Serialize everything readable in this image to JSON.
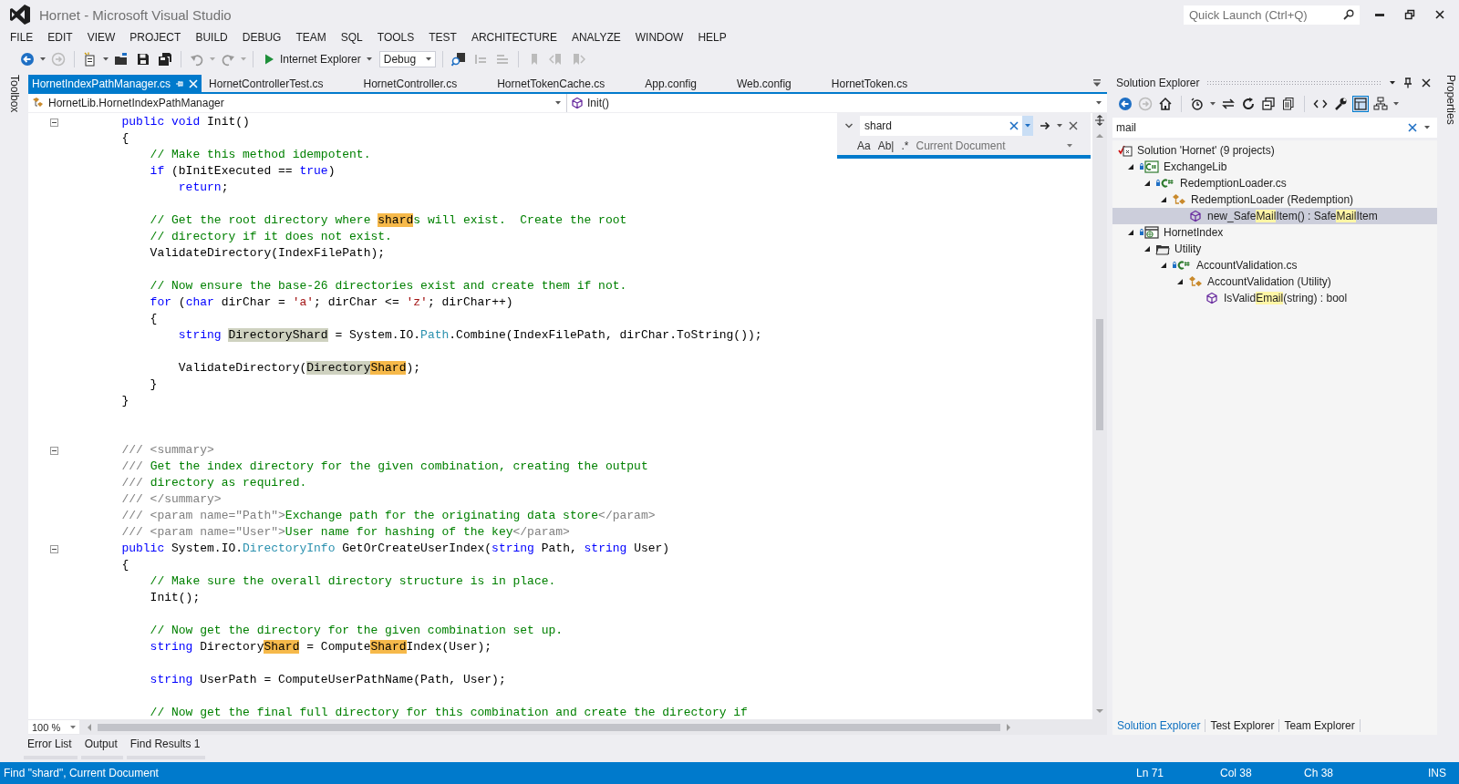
{
  "window": {
    "title": "Hornet - Microsoft Visual Studio"
  },
  "quick_launch": {
    "placeholder": "Quick Launch (Ctrl+Q)"
  },
  "menu": [
    "FILE",
    "EDIT",
    "VIEW",
    "PROJECT",
    "BUILD",
    "DEBUG",
    "TEAM",
    "SQL",
    "TOOLS",
    "TEST",
    "ARCHITECTURE",
    "ANALYZE",
    "WINDOW",
    "HELP"
  ],
  "toolbar": {
    "browser": "Internet Explorer",
    "configuration": "Debug"
  },
  "side_tabs": {
    "left": "Toolbox",
    "right": "Properties"
  },
  "editor": {
    "tabs": [
      {
        "label": "HornetIndexPathManager.cs",
        "selected": true
      },
      {
        "label": "HornetControllerTest.cs",
        "selected": false
      },
      {
        "label": "HornetController.cs",
        "selected": false
      },
      {
        "label": "HornetTokenCache.cs",
        "selected": false
      },
      {
        "label": "App.config",
        "selected": false
      },
      {
        "label": "Web.config",
        "selected": false
      },
      {
        "label": "HornetToken.cs",
        "selected": false
      }
    ],
    "nav": {
      "type": "HornetLib.HornetIndexPathManager",
      "member": "Init()"
    },
    "lines": [
      {
        "kind": "fold",
        "tokens": [
          {
            "text": "        public void",
            "kind": "kw"
          },
          {
            "text": " Init()",
            "kind": "plain"
          }
        ]
      },
      {
        "kind": "code",
        "tokens": [
          {
            "text": "        {",
            "kind": "plain"
          }
        ]
      },
      {
        "kind": "code",
        "tokens": [
          {
            "text": "            // Make this method idempotent.",
            "kind": "comment"
          }
        ]
      },
      {
        "kind": "code",
        "tokens": [
          {
            "text": "            if",
            "kind": "kw"
          },
          {
            "text": " (bInitExecuted == ",
            "kind": "plain"
          },
          {
            "text": "true",
            "kind": "kw"
          },
          {
            "text": ")",
            "kind": "plain"
          }
        ]
      },
      {
        "kind": "code",
        "tokens": [
          {
            "text": "                return",
            "kind": "kw"
          },
          {
            "text": ";",
            "kind": "plain"
          }
        ]
      },
      {
        "kind": "blank"
      },
      {
        "kind": "code",
        "tokens": [
          {
            "text": "            // Get the root directory where ",
            "kind": "comment"
          },
          {
            "text": "shard",
            "kind": "match"
          },
          {
            "text": "s will exist.  Create the root",
            "kind": "comment"
          }
        ]
      },
      {
        "kind": "code",
        "tokens": [
          {
            "text": "            // directory if it does not exist.",
            "kind": "comment"
          }
        ]
      },
      {
        "kind": "code",
        "tokens": [
          {
            "text": "            ValidateDirectory(IndexFilePath);",
            "kind": "plain"
          }
        ]
      },
      {
        "kind": "blank"
      },
      {
        "kind": "code",
        "tokens": [
          {
            "text": "            // Now ensure the base-26 directories exist and create them if not.",
            "kind": "comment"
          }
        ]
      },
      {
        "kind": "code",
        "tokens": [
          {
            "text": "            for",
            "kind": "kw"
          },
          {
            "text": " (",
            "kind": "plain"
          },
          {
            "text": "char",
            "kind": "kw"
          },
          {
            "text": " dirChar = ",
            "kind": "plain"
          },
          {
            "text": "'a'",
            "kind": "string"
          },
          {
            "text": "; dirChar <= ",
            "kind": "plain"
          },
          {
            "text": "'z'",
            "kind": "string"
          },
          {
            "text": "; dirChar++)",
            "kind": "plain"
          }
        ]
      },
      {
        "kind": "code",
        "tokens": [
          {
            "text": "            {",
            "kind": "plain"
          }
        ]
      },
      {
        "kind": "code",
        "tokens": [
          {
            "text": "                string ",
            "kind": "kw"
          },
          {
            "text": "DirectoryShard",
            "kind": "ref"
          },
          {
            "text": " = System.IO.",
            "kind": "plain"
          },
          {
            "text": "Path",
            "kind": "type"
          },
          {
            "text": ".Combine(IndexFilePath, dirChar.ToString());",
            "kind": "plain"
          }
        ]
      },
      {
        "kind": "blank"
      },
      {
        "kind": "code",
        "tokens": [
          {
            "text": "                ValidateDirectory(",
            "kind": "plain"
          },
          {
            "text": "Directory",
            "kind": "ref"
          },
          {
            "text": "Shard",
            "kind": "match"
          },
          {
            "text": ");",
            "kind": "plain"
          }
        ]
      },
      {
        "kind": "code",
        "tokens": [
          {
            "text": "            }",
            "kind": "plain"
          }
        ]
      },
      {
        "kind": "code",
        "tokens": [
          {
            "text": "        }",
            "kind": "plain"
          }
        ]
      },
      {
        "kind": "blank"
      },
      {
        "kind": "blank"
      },
      {
        "kind": "fold",
        "tokens": [
          {
            "text": "        /// <summary>",
            "kind": "doc"
          }
        ]
      },
      {
        "kind": "code",
        "tokens": [
          {
            "text": "        ///",
            "kind": "doc"
          },
          {
            "text": " Get the index directory for the given combination, creating the output",
            "kind": "comment"
          }
        ]
      },
      {
        "kind": "code",
        "tokens": [
          {
            "text": "        ///",
            "kind": "doc"
          },
          {
            "text": " directory as required.",
            "kind": "comment"
          }
        ]
      },
      {
        "kind": "code",
        "tokens": [
          {
            "text": "        /// </summary>",
            "kind": "doc"
          }
        ]
      },
      {
        "kind": "code",
        "tokens": [
          {
            "text": "        /// <param name=\"Path\">",
            "kind": "doc"
          },
          {
            "text": "Exchange path for the originating data store",
            "kind": "comment"
          },
          {
            "text": "</param>",
            "kind": "doc"
          }
        ]
      },
      {
        "kind": "code",
        "tokens": [
          {
            "text": "        /// <param name=\"User\">",
            "kind": "doc"
          },
          {
            "text": "User name for hashing of the key",
            "kind": "comment"
          },
          {
            "text": "</param>",
            "kind": "doc"
          }
        ]
      },
      {
        "kind": "fold",
        "tokens": [
          {
            "text": "        public ",
            "kind": "kw"
          },
          {
            "text": "System.IO.",
            "kind": "plain"
          },
          {
            "text": "DirectoryInfo",
            "kind": "type"
          },
          {
            "text": " GetOrCreateUserIndex(",
            "kind": "plain"
          },
          {
            "text": "string",
            "kind": "kw"
          },
          {
            "text": " Path, ",
            "kind": "plain"
          },
          {
            "text": "string",
            "kind": "kw"
          },
          {
            "text": " User)",
            "kind": "plain"
          }
        ]
      },
      {
        "kind": "code",
        "tokens": [
          {
            "text": "        {",
            "kind": "plain"
          }
        ]
      },
      {
        "kind": "code",
        "tokens": [
          {
            "text": "            // Make sure the overall directory structure is in place.",
            "kind": "comment"
          }
        ]
      },
      {
        "kind": "code",
        "tokens": [
          {
            "text": "            Init();",
            "kind": "plain"
          }
        ]
      },
      {
        "kind": "blank"
      },
      {
        "kind": "code",
        "tokens": [
          {
            "text": "            // Now get the directory for the given combination set up.",
            "kind": "comment"
          }
        ]
      },
      {
        "kind": "code",
        "tokens": [
          {
            "text": "            string ",
            "kind": "kw"
          },
          {
            "text": "Directory",
            "kind": "plain"
          },
          {
            "text": "Shard",
            "kind": "match"
          },
          {
            "text": " = Compute",
            "kind": "plain"
          },
          {
            "text": "Shard",
            "kind": "match"
          },
          {
            "text": "Index(User);",
            "kind": "plain"
          }
        ]
      },
      {
        "kind": "blank"
      },
      {
        "kind": "code",
        "tokens": [
          {
            "text": "            string ",
            "kind": "kw"
          },
          {
            "text": "UserPath = ComputeUserPathName(Path, User);",
            "kind": "plain"
          }
        ]
      },
      {
        "kind": "blank"
      },
      {
        "kind": "code",
        "tokens": [
          {
            "text": "            // Now get the final full directory for this combination and create the directory if",
            "kind": "comment"
          }
        ]
      }
    ],
    "zoom": "100 %"
  },
  "find": {
    "query": "shard",
    "options": [
      "Aa",
      "Ab|",
      ".*"
    ],
    "scope": "Current Document"
  },
  "solution_explorer": {
    "title": "Solution Explorer",
    "search": "mail",
    "tree": [
      {
        "kind": "solution",
        "selected": false,
        "label": [
          {
            "text": "Solution 'Hornet' (9 projects)",
            "match": false
          }
        ],
        "children": [
          {
            "kind": "csproj",
            "expanded": true,
            "selected": false,
            "label": [
              {
                "text": "ExchangeLib",
                "match": false
              }
            ],
            "children": [
              {
                "kind": "csfile",
                "expanded": true,
                "selected": false,
                "label": [
                  {
                    "text": "RedemptionLoader.cs",
                    "match": false
                  }
                ],
                "children": [
                  {
                    "kind": "class",
                    "expanded": true,
                    "selected": false,
                    "label": [
                      {
                        "text": "RedemptionLoader  (Redemption)",
                        "match": false
                      }
                    ],
                    "children": [
                      {
                        "kind": "method",
                        "selected": true,
                        "label": [
                          {
                            "text": "new_Safe",
                            "match": false
                          },
                          {
                            "text": "Mail",
                            "match": true
                          },
                          {
                            "text": "Item() : Safe",
                            "match": false
                          },
                          {
                            "text": "Mail",
                            "match": true
                          },
                          {
                            "text": "Item",
                            "match": false
                          }
                        ]
                      }
                    ]
                  }
                ]
              }
            ]
          },
          {
            "kind": "webproj",
            "expanded": true,
            "selected": false,
            "label": [
              {
                "text": "HornetIndex",
                "match": false
              }
            ],
            "children": [
              {
                "kind": "folder",
                "expanded": true,
                "selected": false,
                "label": [
                  {
                    "text": "Utility",
                    "match": false
                  }
                ],
                "children": [
                  {
                    "kind": "csfile",
                    "expanded": true,
                    "selected": false,
                    "label": [
                      {
                        "text": "AccountValidation.cs",
                        "match": false
                      }
                    ],
                    "children": [
                      {
                        "kind": "class",
                        "expanded": true,
                        "selected": false,
                        "label": [
                          {
                            "text": "AccountValidation  (Utility)",
                            "match": false
                          }
                        ],
                        "children": [
                          {
                            "kind": "method",
                            "selected": false,
                            "label": [
                              {
                                "text": "IsValid",
                                "match": false
                              },
                              {
                                "text": "Email",
                                "match": true
                              },
                              {
                                "text": "(string) : bool",
                                "match": false
                              }
                            ]
                          }
                        ]
                      }
                    ]
                  }
                ]
              }
            ]
          }
        ]
      }
    ],
    "tabs": [
      {
        "label": "Solution Explorer",
        "selected": true
      },
      {
        "label": "Test Explorer",
        "selected": false
      },
      {
        "label": "Team Explorer",
        "selected": false
      }
    ]
  },
  "bottom_tabs": [
    "Error List",
    "Output",
    "Find Results 1"
  ],
  "status_bar": {
    "message": "Find \"shard\", Current Document",
    "line": "Ln 71",
    "column": "Col 38",
    "char": "Ch 38",
    "mode": "INS"
  }
}
